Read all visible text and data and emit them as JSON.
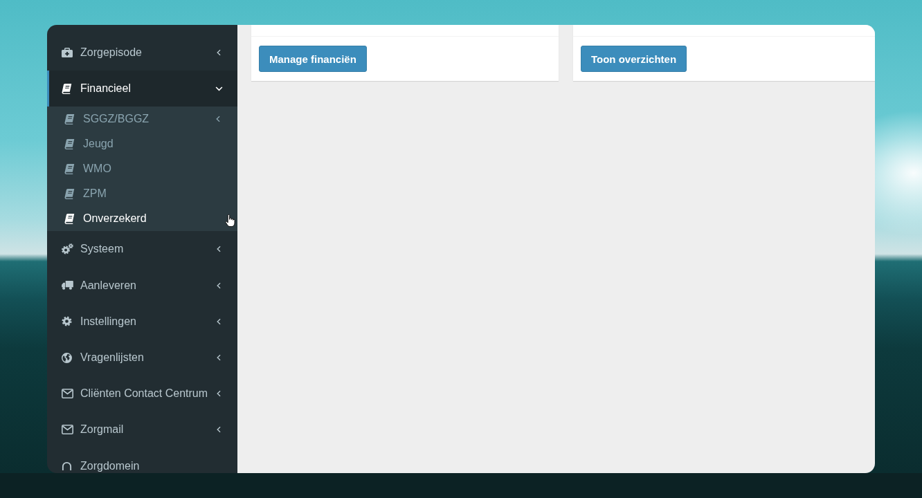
{
  "sidebar": {
    "items": [
      {
        "label": "Zorgepisode",
        "selected": false,
        "expanded": false
      },
      {
        "label": "Financieel",
        "selected": true,
        "expanded": true,
        "children": [
          {
            "label": "SGGZ/BGGZ",
            "kind": "group",
            "selected": false,
            "expanded": false
          },
          {
            "label": "Jeugd",
            "kind": "link",
            "selected": false
          },
          {
            "label": "WMO",
            "kind": "link",
            "selected": false
          },
          {
            "label": "ZPM",
            "kind": "link",
            "selected": false
          },
          {
            "label": "Onverzekerd",
            "kind": "link",
            "selected": true
          }
        ]
      },
      {
        "label": "Systeem",
        "selected": false,
        "expanded": false
      },
      {
        "label": "Aanleveren",
        "selected": false,
        "expanded": false
      },
      {
        "label": "Instellingen",
        "selected": false,
        "expanded": false
      },
      {
        "label": "Vragenlijsten",
        "selected": false,
        "expanded": false
      },
      {
        "label": "Cliënten Contact Centrum",
        "selected": false,
        "expanded": false
      },
      {
        "label": "Zorgmail",
        "selected": false,
        "expanded": false
      },
      {
        "label": "Zorgdomein",
        "selected": false
      }
    ]
  },
  "cards": [
    {
      "button": "Manage financiën"
    },
    {
      "button": "Toon overzichten"
    }
  ]
}
